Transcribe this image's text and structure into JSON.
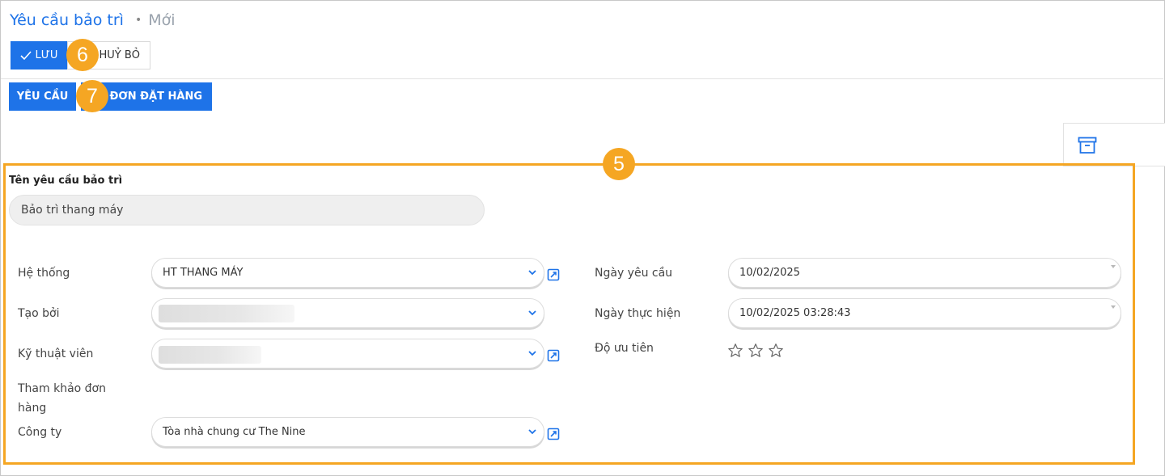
{
  "breadcrumb": {
    "parent": "Yêu cầu bảo trì",
    "separator": "•",
    "current": "Mới"
  },
  "toolbar": {
    "save_label": "LƯU",
    "cancel_label": "HUỶ BỎ"
  },
  "action_tabs": {
    "request_label": "YÊU CẦU",
    "order_label": "O ĐƠN ĐẶT HÀNG"
  },
  "badges": {
    "save_area": "6",
    "tabs_area": "7",
    "form_area": "5"
  },
  "form": {
    "name_label": "Tên yêu cầu bảo trì",
    "name_value": "Bảo trì thang máy",
    "left_fields": {
      "system": {
        "label": "Hệ thống",
        "value": "HT THANG MÁY"
      },
      "created_by": {
        "label": "Tạo bởi",
        "value": ""
      },
      "technician": {
        "label": "Kỹ thuật viên",
        "value": ""
      },
      "order_ref": {
        "label": "Tham khảo đơn hàng"
      },
      "company": {
        "label": "Công ty",
        "value": "Tòa nhà chung cư The Nine"
      }
    },
    "right_fields": {
      "request_date": {
        "label": "Ngày yêu cầu",
        "value": "10/02/2025"
      },
      "execution_date": {
        "label": "Ngày thực hiện",
        "value": "10/02/2025 03:28:43"
      },
      "priority": {
        "label": "Độ ưu tiên",
        "stars_total": 3,
        "stars_filled": 0
      }
    }
  },
  "icons": {
    "save": "check-icon",
    "archive": "archive-icon",
    "dropdown": "chevron-down-icon",
    "external": "external-link-icon",
    "priority": "star-icon"
  },
  "colors": {
    "primary": "#1e73e8",
    "highlight": "#f5a623",
    "badge_text": "#ffffff"
  }
}
